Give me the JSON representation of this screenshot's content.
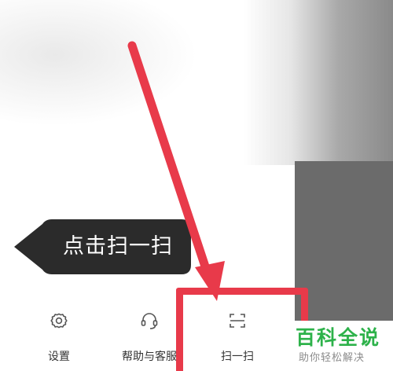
{
  "tooltip": {
    "text": "点击扫一扫"
  },
  "actions": [
    {
      "label": "设置",
      "icon": "gear-icon"
    },
    {
      "label": "帮助与客服",
      "icon": "headset-icon"
    },
    {
      "label": "扫一扫",
      "icon": "scan-icon"
    }
  ],
  "annotation": {
    "color": "#e83a4a"
  },
  "watermark": {
    "title": "百科全说",
    "subtitle": "助你轻松解决",
    "color": "#2db24a"
  }
}
